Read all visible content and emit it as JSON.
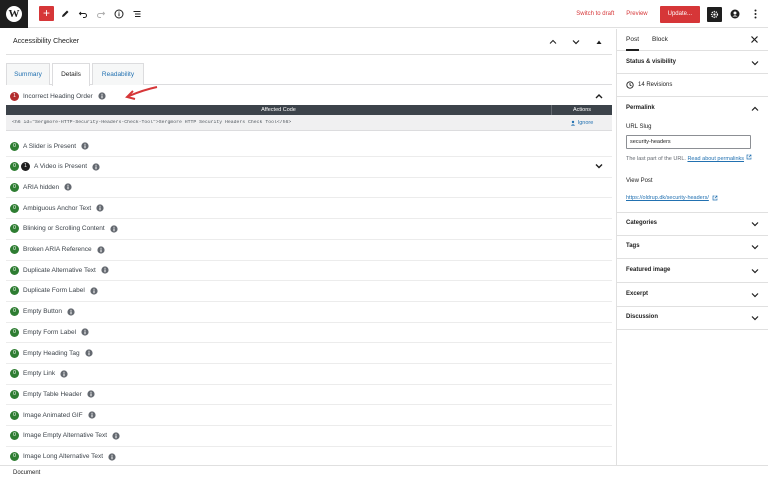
{
  "toolbar": {
    "switch_draft": "Switch to draft",
    "preview": "Preview",
    "update": "Update..."
  },
  "panel": {
    "title": "Accessibility Checker",
    "tabs": [
      "Summary",
      "Details",
      "Readability"
    ]
  },
  "error_item": {
    "count": "1",
    "label": "Incorrect Heading Order"
  },
  "table": {
    "col_code": "Affected Code",
    "col_actions": "Actions",
    "code": "<h6 id=\"Sergmore-HTTP-Security-Headers-Check-Tool\">Sergmore HTTP Security Headers Check Tool</h6>",
    "ignore": "Ignore"
  },
  "items": [
    {
      "badges": [
        "0"
      ],
      "label": "A Slider is Present"
    },
    {
      "badges": [
        "0",
        "1"
      ],
      "label": "A Video is Present"
    },
    {
      "badges": [
        "0"
      ],
      "label": "ARIA hidden"
    },
    {
      "badges": [
        "0"
      ],
      "label": "Ambiguous Anchor Text"
    },
    {
      "badges": [
        "0"
      ],
      "label": "Blinking or Scrolling Content"
    },
    {
      "badges": [
        "0"
      ],
      "label": "Broken ARIA Reference"
    },
    {
      "badges": [
        "0"
      ],
      "label": "Duplicate Alternative Text"
    },
    {
      "badges": [
        "0"
      ],
      "label": "Duplicate Form Label"
    },
    {
      "badges": [
        "0"
      ],
      "label": "Empty Button"
    },
    {
      "badges": [
        "0"
      ],
      "label": "Empty Form Label"
    },
    {
      "badges": [
        "0"
      ],
      "label": "Empty Heading Tag"
    },
    {
      "badges": [
        "0"
      ],
      "label": "Empty Link"
    },
    {
      "badges": [
        "0"
      ],
      "label": "Empty Table Header"
    },
    {
      "badges": [
        "0"
      ],
      "label": "Image Animated GIF"
    },
    {
      "badges": [
        "0"
      ],
      "label": "Image Empty Alternative Text"
    },
    {
      "badges": [
        "0"
      ],
      "label": "Image Long Alternative Text"
    }
  ],
  "footer": {
    "label": "Document"
  },
  "sidebar": {
    "tab_post": "Post",
    "tab_block": "Block",
    "status_visibility": "Status & visibility",
    "revisions": "14 Revisions",
    "permalink": "Permalink",
    "url_slug_label": "URL Slug",
    "url_slug_value": "security-headers",
    "help_text": "The last part of the URL.",
    "help_link": "Read about permalinks",
    "view_post": "View Post",
    "view_link": "https://oldrup.dk/security-headers/",
    "categories": "Categories",
    "tags": "Tags",
    "featured_image": "Featured image",
    "excerpt": "Excerpt",
    "discussion": "Discussion"
  },
  "colors": {
    "accent_red": "#d63638",
    "badge_green": "#2e7d32",
    "badge_red": "#b32d2e",
    "link_blue": "#2271b1"
  }
}
